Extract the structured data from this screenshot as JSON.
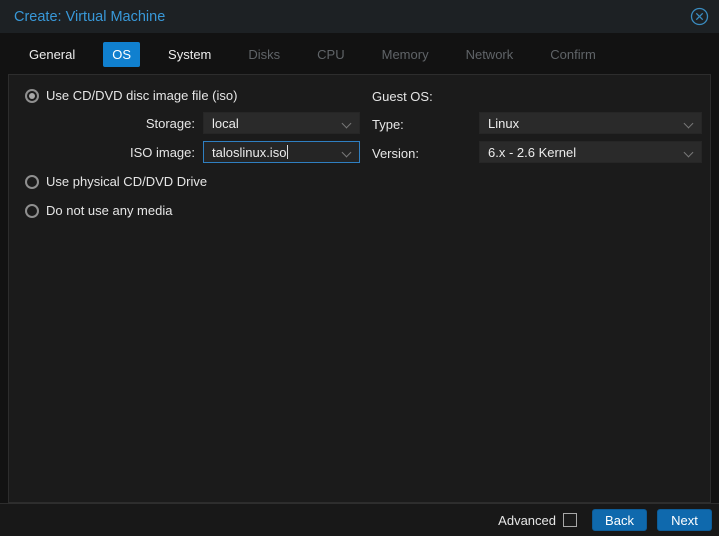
{
  "window": {
    "title": "Create: Virtual Machine"
  },
  "tabs": [
    {
      "label": "General",
      "state": "enabled"
    },
    {
      "label": "OS",
      "state": "selected"
    },
    {
      "label": "System",
      "state": "enabled"
    },
    {
      "label": "Disks",
      "state": "disabled"
    },
    {
      "label": "CPU",
      "state": "disabled"
    },
    {
      "label": "Memory",
      "state": "disabled"
    },
    {
      "label": "Network",
      "state": "disabled"
    },
    {
      "label": "Confirm",
      "state": "disabled"
    }
  ],
  "form": {
    "media": {
      "radio_iso": {
        "label": "Use CD/DVD disc image file (iso)",
        "selected": true
      },
      "storage": {
        "label": "Storage:",
        "value": "local"
      },
      "iso_image": {
        "label": "ISO image:",
        "value": "taloslinux.iso",
        "focused": true
      },
      "radio_physical": {
        "label": "Use physical CD/DVD Drive",
        "selected": false
      },
      "radio_none": {
        "label": "Do not use any media",
        "selected": false
      }
    },
    "guest_os": {
      "header": "Guest OS:",
      "type": {
        "label": "Type:",
        "value": "Linux"
      },
      "version": {
        "label": "Version:",
        "value": "6.x - 2.6 Kernel"
      }
    }
  },
  "footer": {
    "advanced_label": "Advanced",
    "advanced_checked": false,
    "back_label": "Back",
    "next_label": "Next"
  },
  "colors": {
    "accent_tab": "#1080cf",
    "button_blue": "#0f69ad",
    "title_blue": "#3898d8",
    "focus_border": "#2f7fc1",
    "panel_bg": "#1b1b1b",
    "titlebar_bg": "#1d2124"
  },
  "icons": {
    "close": "close-circle-icon",
    "dropdown": "chevron-down-icon"
  }
}
